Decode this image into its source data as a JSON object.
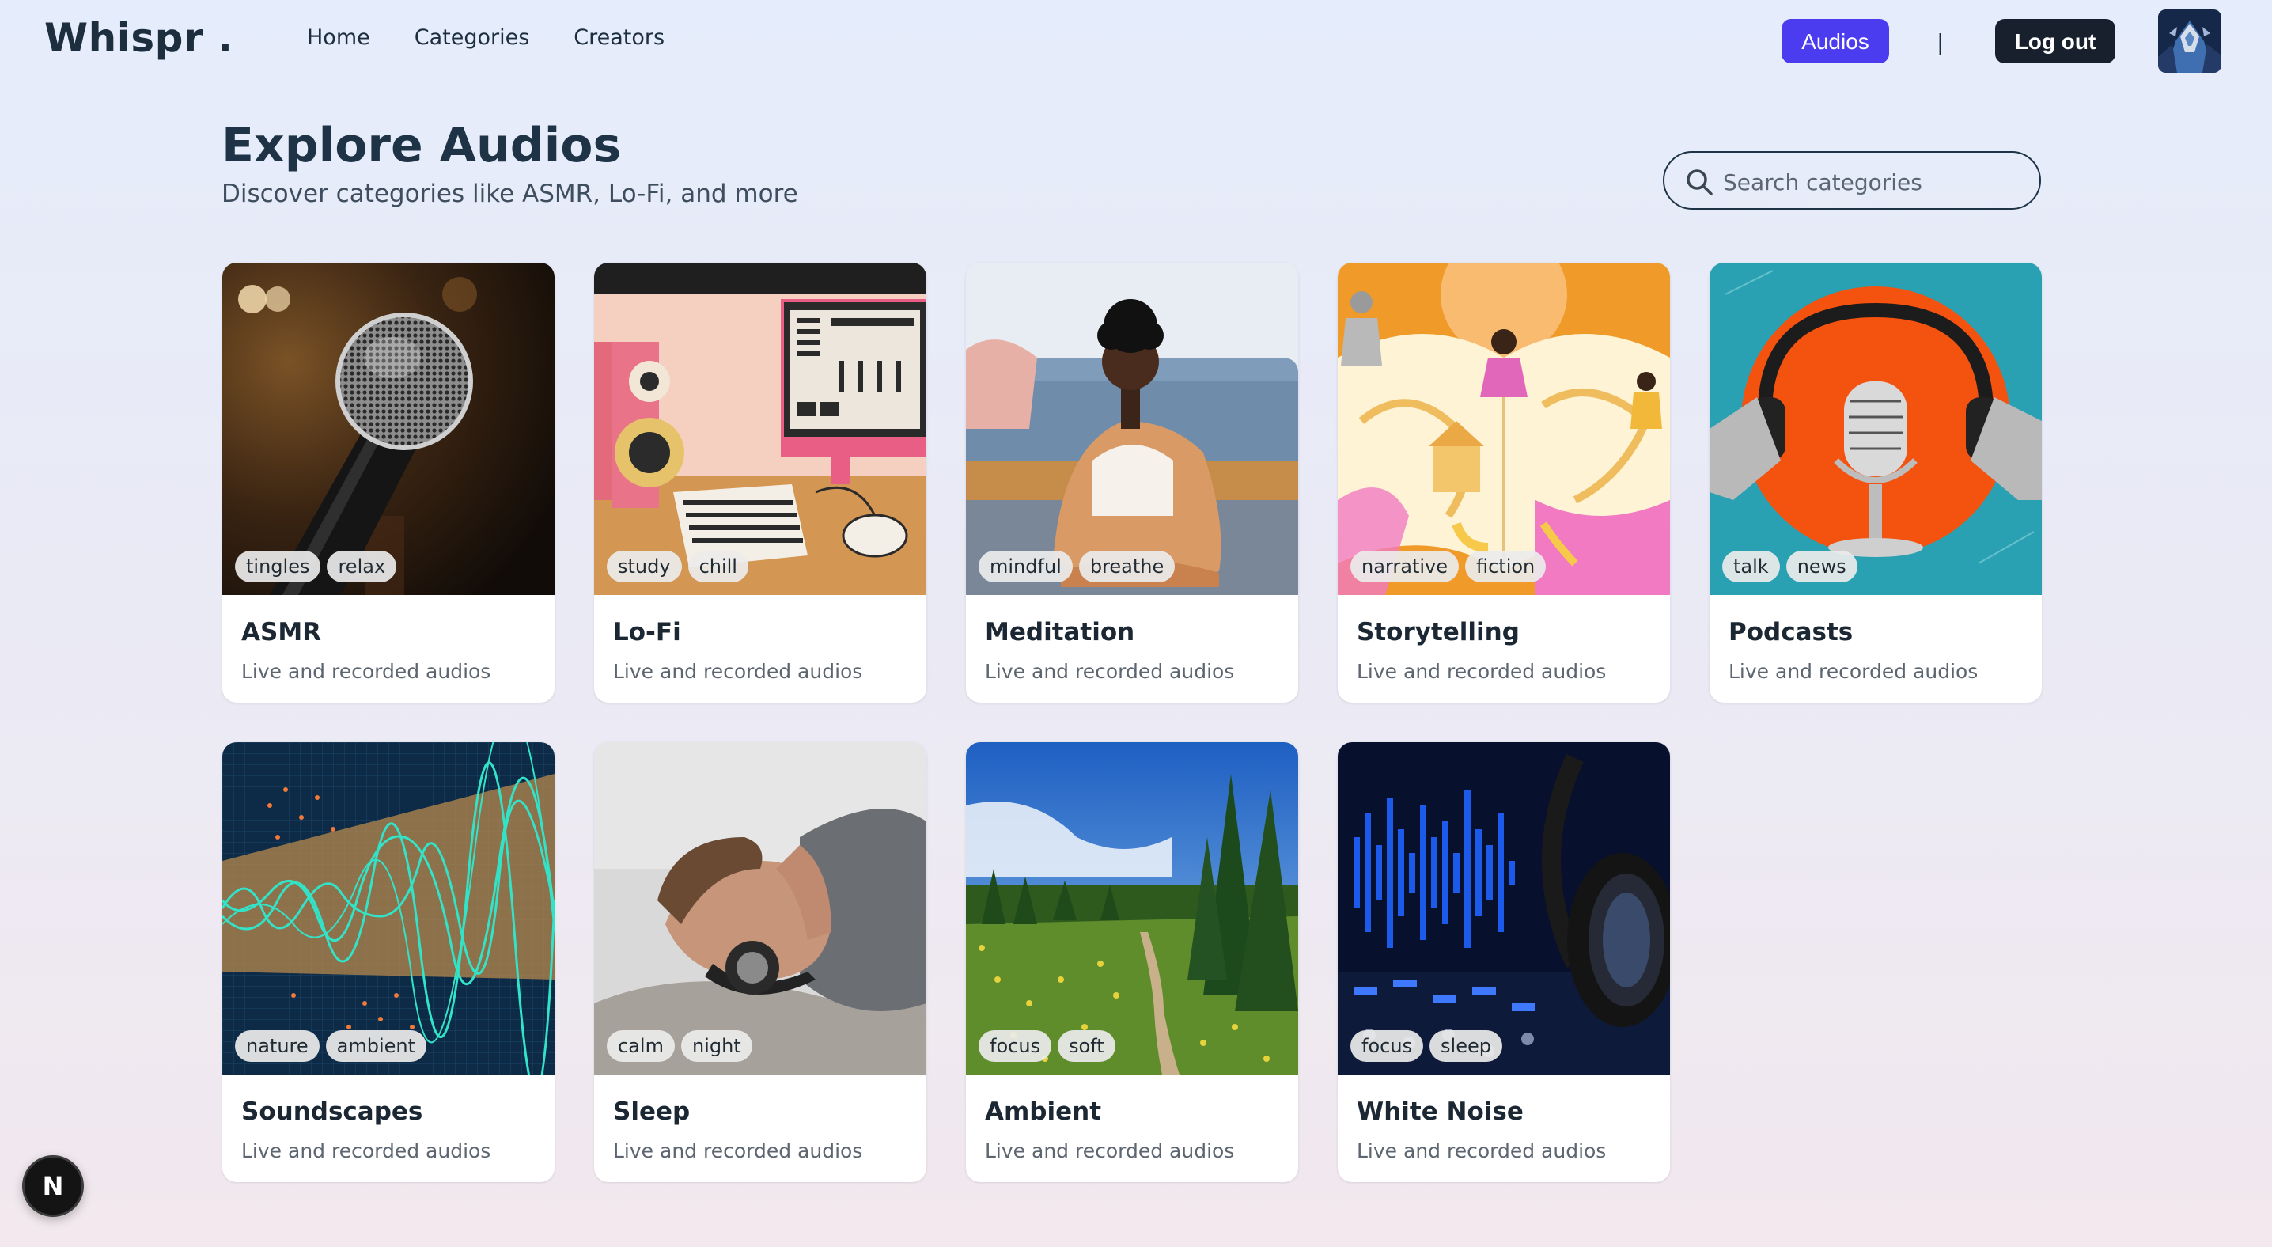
{
  "nav": {
    "logo": "Whispr .",
    "links": [
      "Home",
      "Categories",
      "Creators"
    ],
    "audios_label": "Audios",
    "separator": "|",
    "logout_label": "Log out"
  },
  "header": {
    "title": "Explore Audios",
    "subtitle": "Discover categories like ASMR, Lo-Fi, and more"
  },
  "search": {
    "placeholder": "Search categories"
  },
  "categories": [
    {
      "name": "ASMR",
      "subtitle": "Live and recorded audios",
      "tags": [
        "tingles",
        "relax"
      ]
    },
    {
      "name": "Lo-Fi",
      "subtitle": "Live and recorded audios",
      "tags": [
        "study",
        "chill"
      ]
    },
    {
      "name": "Meditation",
      "subtitle": "Live and recorded audios",
      "tags": [
        "mindful",
        "breathe"
      ]
    },
    {
      "name": "Storytelling",
      "subtitle": "Live and recorded audios",
      "tags": [
        "narrative",
        "fiction"
      ]
    },
    {
      "name": "Podcasts",
      "subtitle": "Live and recorded audios",
      "tags": [
        "talk",
        "news"
      ]
    },
    {
      "name": "Soundscapes",
      "subtitle": "Live and recorded audios",
      "tags": [
        "nature",
        "ambient"
      ]
    },
    {
      "name": "Sleep",
      "subtitle": "Live and recorded audios",
      "tags": [
        "calm",
        "night"
      ]
    },
    {
      "name": "Ambient",
      "subtitle": "Live and recorded audios",
      "tags": [
        "focus",
        "soft"
      ]
    },
    {
      "name": "White Noise",
      "subtitle": "Live and recorded audios",
      "tags": [
        "focus",
        "sleep"
      ]
    }
  ],
  "fab": {
    "label": "N"
  },
  "colors": {
    "accent": "#4b3cf0",
    "dark_button": "#17202c",
    "title": "#1e3346"
  }
}
